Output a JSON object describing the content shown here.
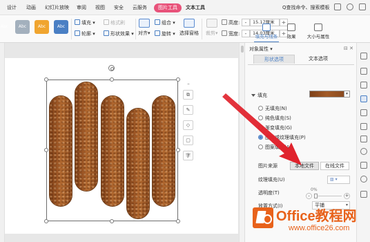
{
  "menu": {
    "tabs": [
      "设计",
      "动画",
      "幻灯片放映",
      "审阅",
      "视图",
      "安全",
      "云服务",
      "图片工具",
      "文本工具"
    ],
    "active_tab": "图片工具",
    "search": "Q查找命令、搜索模板"
  },
  "ribbon": {
    "styles": [
      {
        "label": "Abc",
        "color": "#4a7fc4"
      },
      {
        "label": "Abc",
        "color": "#8c9aa8"
      },
      {
        "label": "Abc",
        "color": "#f0a530"
      },
      {
        "label": "Abc",
        "color": "#4a7fc4"
      }
    ],
    "fill": "填充",
    "outline": "轮廓",
    "format_painter": "格式刷",
    "shape_effects": "形状效果",
    "align": "对齐",
    "group": "组合",
    "rotate": "旋转",
    "selection_pane": "选择窗格",
    "crop": "裁剪",
    "height_label": "高度:",
    "height_value": "15.17厘米",
    "width_label": "宽度:",
    "width_value": "14.03厘米",
    "minus": "-",
    "plus": "+"
  },
  "float_toolbar": [
    "⧉",
    "✎",
    "◇",
    "▢",
    "字"
  ],
  "pane": {
    "title": "对象属性",
    "tabs": [
      "形状选项",
      "文本选项"
    ],
    "active_tab": "形状选项",
    "subtabs": [
      "填充与线条",
      "效果",
      "大小与属性"
    ],
    "active_subtab": "填充与线条",
    "fill_section": "填充",
    "fill_options": [
      {
        "label": "无填充(N)",
        "checked": false
      },
      {
        "label": "纯色填充(S)",
        "checked": false
      },
      {
        "label": "渐变填充(G)",
        "checked": false
      },
      {
        "label": "图片或纹理填充(P)",
        "checked": true
      },
      {
        "label": "图案填充(A)",
        "checked": false
      }
    ],
    "image_source_label": "图片来源",
    "local_file": "本地文件",
    "online_file": "在线文件",
    "texture_label": "纹理填充(U)",
    "transparency_label": "透明度(T)",
    "transparency_value": "0%",
    "placement_label": "放置方式(I)",
    "placement_value": "平铺"
  },
  "watermark": {
    "title": "Office教程网",
    "url": "www.office26.com"
  }
}
